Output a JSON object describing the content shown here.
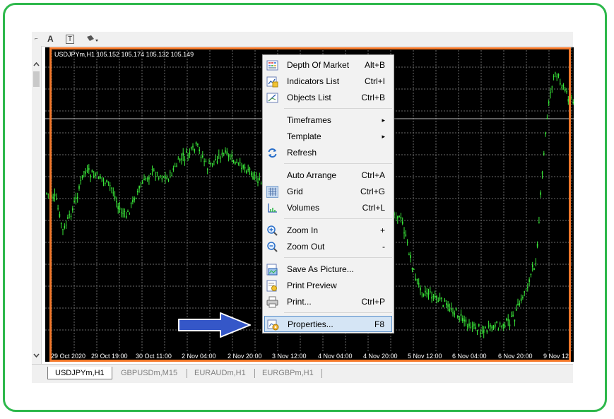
{
  "chart": {
    "header": "USDJPYm,H1  105.152 105.174 105.132 105.149",
    "x_labels": [
      "29 Oct 2020",
      "29 Oct 19:00",
      "30 Oct 11:00",
      "2 Nov 04:00",
      "2 Nov 20:00",
      "3 Nov 12:00",
      "4 Nov 04:00",
      "4 Nov 20:00",
      "5 Nov 12:00",
      "6 Nov 04:00",
      "6 Nov 20:00",
      "9 Nov 12"
    ]
  },
  "toolbar": {
    "text_tool": "A",
    "label_tool": "T",
    "shapes_tool": "▾"
  },
  "context_menu": {
    "items": [
      {
        "label": "Depth Of Market",
        "shortcut": "Alt+B",
        "icon": "depth-of-market-icon"
      },
      {
        "label": "Indicators List",
        "shortcut": "Ctrl+I",
        "icon": "indicators-list-icon"
      },
      {
        "label": "Objects List",
        "shortcut": "Ctrl+B",
        "icon": "objects-list-icon"
      },
      {
        "label": "Timeframes",
        "shortcut": "▸",
        "icon": ""
      },
      {
        "label": "Template",
        "shortcut": "▸",
        "icon": ""
      },
      {
        "label": "Refresh",
        "shortcut": "",
        "icon": "refresh-icon"
      },
      {
        "label": "Auto Arrange",
        "shortcut": "Ctrl+A",
        "icon": ""
      },
      {
        "label": "Grid",
        "shortcut": "Ctrl+G",
        "icon": "grid-icon"
      },
      {
        "label": "Volumes",
        "shortcut": "Ctrl+L",
        "icon": "volumes-icon"
      },
      {
        "label": "Zoom In",
        "shortcut": "+",
        "icon": "zoom-in-icon"
      },
      {
        "label": "Zoom Out",
        "shortcut": "-",
        "icon": "zoom-out-icon"
      },
      {
        "label": "Save As Picture...",
        "shortcut": "",
        "icon": "save-picture-icon"
      },
      {
        "label": "Print Preview",
        "shortcut": "",
        "icon": "print-preview-icon"
      },
      {
        "label": "Print...",
        "shortcut": "Ctrl+P",
        "icon": "print-icon"
      },
      {
        "label": "Properties...",
        "shortcut": "F8",
        "icon": "properties-icon"
      }
    ]
  },
  "tabs": [
    "USDJPYm,H1",
    "GBPUSDm,M15",
    "EURAUDm,H1",
    "EURGBPm,H1"
  ],
  "colors": {
    "accent_frame": "#2db84b",
    "highlight_border": "#f4782a",
    "candles": "#39e639",
    "arrow": "#3557c8"
  }
}
